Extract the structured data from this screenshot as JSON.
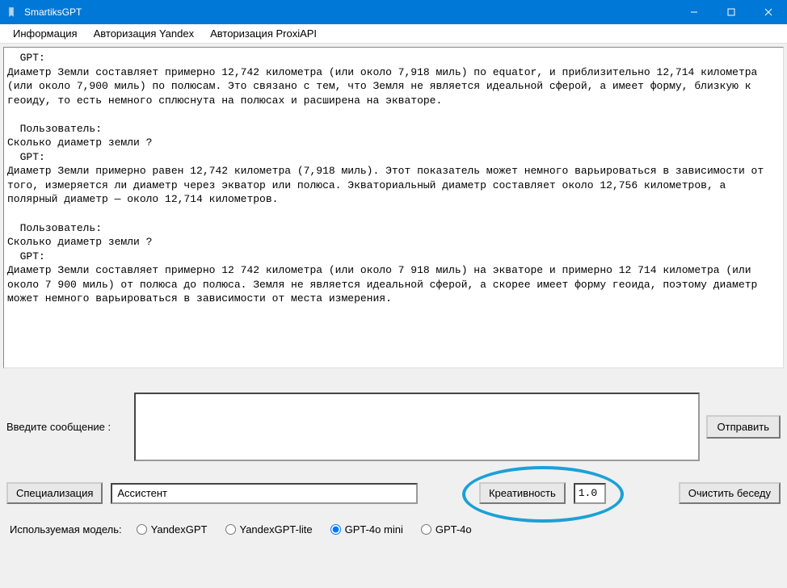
{
  "window": {
    "title": "SmartiksGPT"
  },
  "menubar": {
    "items": [
      "Информация",
      "Авторизация Yandex",
      "Авторизация ProxiAPI"
    ]
  },
  "chat": {
    "content": "  GPT:\nДиаметр Земли составляет примерно 12,742 километра (или около 7,918 миль) по equator, и приблизительно 12,714 километра (или около 7,900 миль) по полюсам. Это связано с тем, что Земля не является идеальной сферой, а имеет форму, близкую к геоиду, то есть немного сплюснута на полюсах и расширена на экваторе.\n\n  Пользователь:\nСколько диаметр земли ?\n  GPT:\nДиаметр Земли примерно равен 12,742 километра (7,918 миль). Этот показатель может немного варьироваться в зависимости от того, измеряется ли диаметр через экватор или полюса. Экваториальный диаметр составляет около 12,756 километров, а полярный диаметр — около 12,714 километров.\n\n  Пользователь:\nСколько диаметр земли ?\n  GPT:\nДиаметр Земли составляет примерно 12 742 километра (или около 7 918 миль) на экваторе и примерно 12 714 километра (или около 7 900 миль) от полюса до полюса. Земля не является идеальной сферой, а скорее имеет форму геоида, поэтому диаметр может немного варьироваться в зависимости от места измерения."
  },
  "input": {
    "label": "Введите сообщение :",
    "value": "",
    "send_label": "Отправить"
  },
  "controls": {
    "spec_button": "Специализация",
    "spec_value": "Ассистент",
    "creativity_button": "Креативность",
    "creativity_value": "1.0",
    "clear_button": "Очистить беседу"
  },
  "model": {
    "label": "Используемая модель:",
    "options": [
      "YandexGPT",
      "YandexGPT-lite",
      "GPT-4o mini",
      "GPT-4o"
    ],
    "selected": "GPT-4o mini"
  }
}
